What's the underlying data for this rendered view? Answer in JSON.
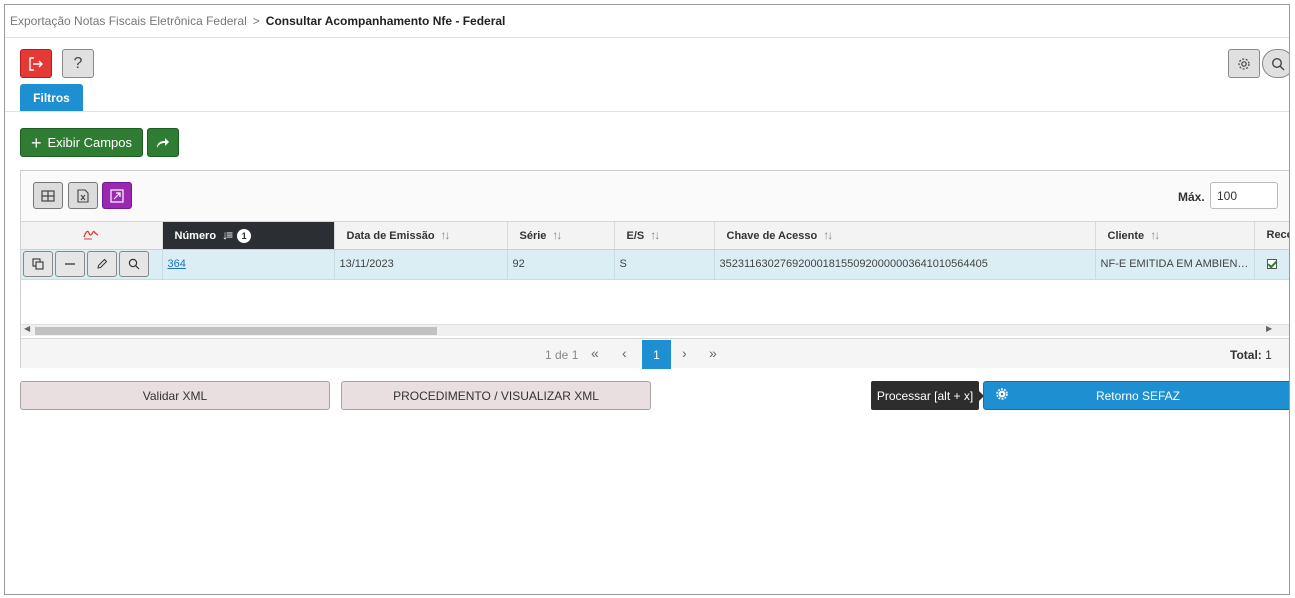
{
  "breadcrumb": {
    "parent": "Exportação Notas Fiscais Eletrônica Federal",
    "separator": ">",
    "current": "Consultar Acompanhamento Nfe - Federal"
  },
  "toolbar": {
    "exit_icon": "exit-icon",
    "help_label": "?",
    "settings_icon": "gear-icon",
    "search_icon": "search-icon"
  },
  "tabs": {
    "filtros": "Filtros"
  },
  "actions": {
    "exibir_campos_label": "Exibir Campos",
    "share_icon": "share-arrow-icon"
  },
  "grid": {
    "max_label": "Máx.",
    "max_value": "100",
    "columns": [
      {
        "key": "actions",
        "label": ""
      },
      {
        "key": "numero",
        "label": "Número",
        "sort_order": "1"
      },
      {
        "key": "data_emissao",
        "label": "Data de Emissão"
      },
      {
        "key": "serie",
        "label": "Série"
      },
      {
        "key": "es",
        "label": "E/S"
      },
      {
        "key": "chave",
        "label": "Chave de Acesso"
      },
      {
        "key": "cliente",
        "label": "Cliente"
      },
      {
        "key": "rece",
        "label": "Rece"
      }
    ],
    "rows": [
      {
        "numero": "364",
        "data_emissao": "13/11/2023",
        "serie": "92",
        "es": "S",
        "chave": "35231163027692000181550920000003641010564405",
        "cliente": "NF-E EMITIDA EM AMBIENTE DE HOMOLOGACAO - SEM VALOR FISCAL",
        "rece_checked": true
      }
    ],
    "pager": {
      "info": "1 de 1",
      "first": "«",
      "prev": "‹",
      "current": "1",
      "next": "›",
      "last": "»",
      "total_label": "Total:",
      "total_value": "1"
    }
  },
  "bottom": {
    "validar_label": "Validar XML",
    "procedimento_label": "PROCEDIMENTO / VISUALIZAR XML",
    "tooltip": "Processar [alt + x]",
    "retorno_label": "Retorno SEFAZ"
  },
  "colors": {
    "primary_blue": "#1e8fd0",
    "exit_red": "#e53935",
    "green": "#2e7d32",
    "purple": "#9c27b0",
    "row_highlight": "#daeef4",
    "sorted_header": "#2b2f33"
  }
}
